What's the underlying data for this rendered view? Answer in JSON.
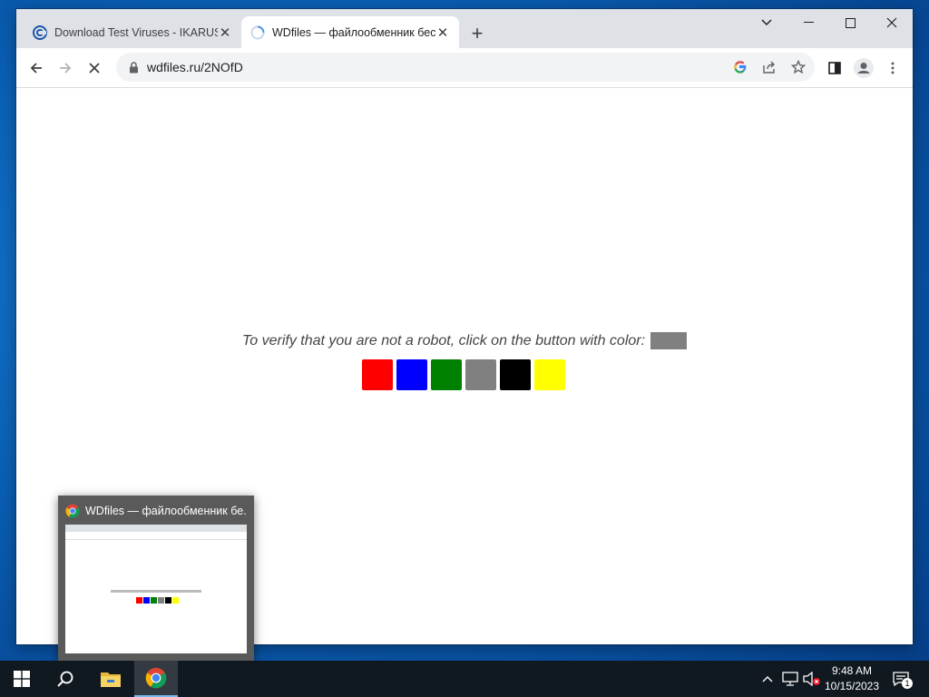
{
  "browser": {
    "tabs": [
      {
        "title": "Download Test Viruses - IKARUS",
        "active": false
      },
      {
        "title": "WDfiles — файлообменник бесплатный",
        "active": true
      }
    ],
    "address": {
      "url": "wdfiles.ru/2NOfD"
    }
  },
  "page": {
    "prompt": "To verify that you are not a robot, click on the button with color:",
    "target_color": "#808080",
    "choices": [
      {
        "name": "red",
        "color": "#ff0000"
      },
      {
        "name": "blue",
        "color": "#0000ff"
      },
      {
        "name": "green",
        "color": "#008000"
      },
      {
        "name": "gray",
        "color": "#808080"
      },
      {
        "name": "black",
        "color": "#000000"
      },
      {
        "name": "yellow",
        "color": "#ffff00"
      }
    ]
  },
  "preview": {
    "title": "WDfiles — файлообменник бе..."
  },
  "taskbar": {
    "time": "9:48 AM",
    "date": "10/15/2023",
    "notification_count": "1"
  }
}
